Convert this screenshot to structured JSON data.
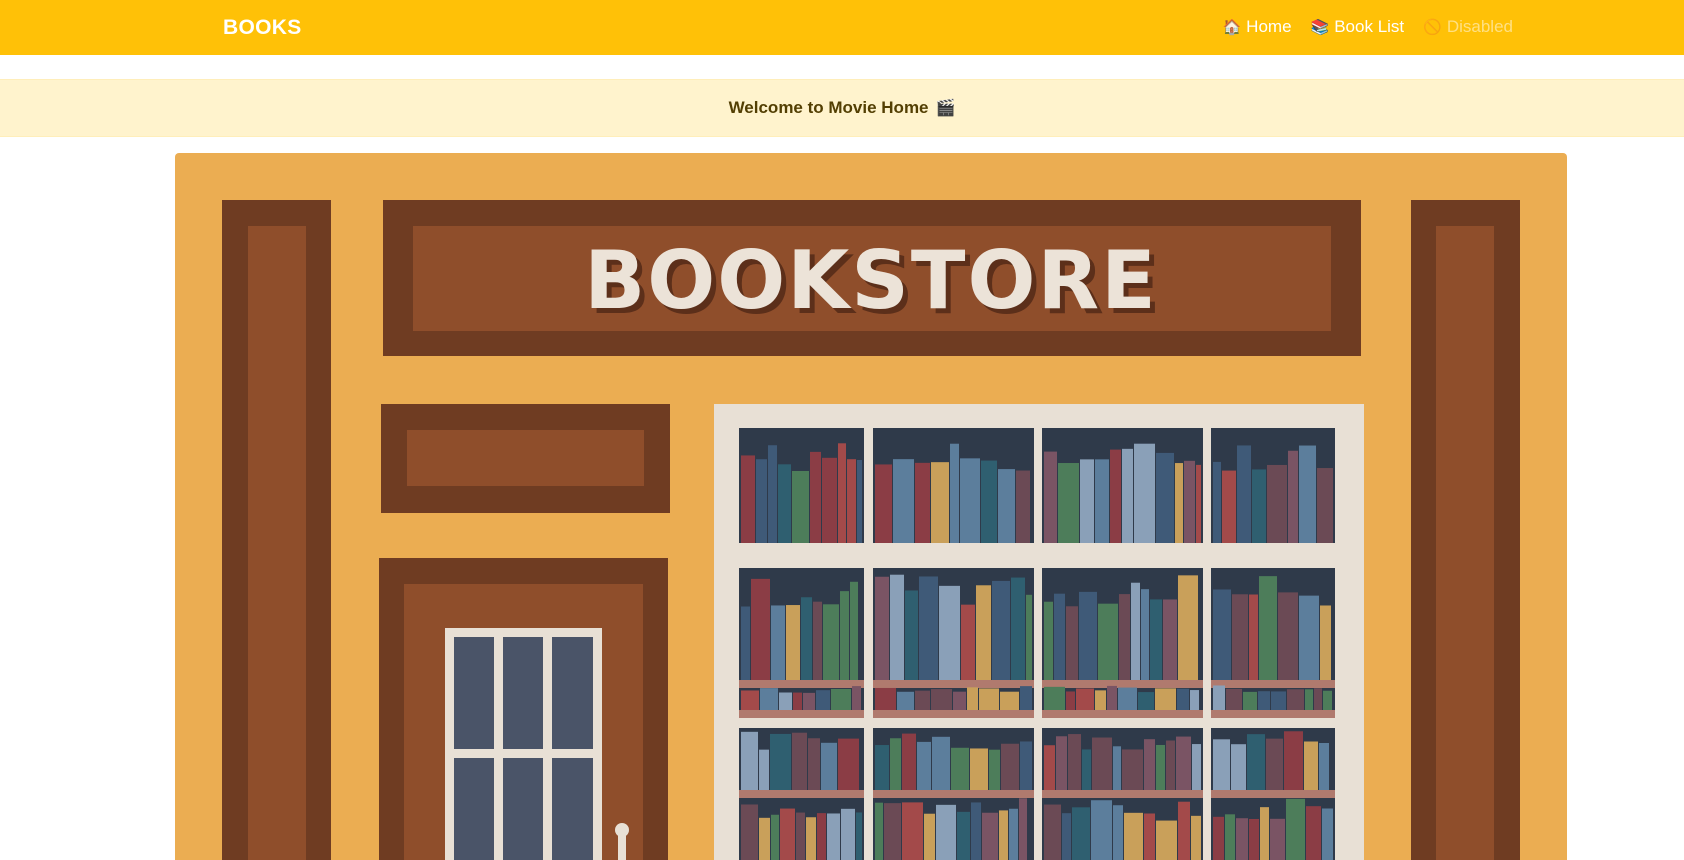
{
  "navbar": {
    "brand": "BOOKS",
    "links": [
      {
        "icon": "🏠",
        "label": "Home",
        "disabled": false
      },
      {
        "icon": "📚",
        "label": "Book List",
        "disabled": false
      },
      {
        "icon": "🚫",
        "label": "Disabled",
        "disabled": true
      }
    ]
  },
  "alert": {
    "text": "Welcome to Movie Home",
    "icon": "🎬"
  },
  "hero": {
    "sign_text": "BOOKSTORE",
    "colors": {
      "wall": "#ebad52",
      "wood_dark": "#6f3c22",
      "wood_mid": "#8f4e2b",
      "window_frame": "#e8e0d5",
      "glass_dark": "#2f3a4a",
      "door_glass": "#4a5468",
      "shelf": "#b07a6e"
    }
  }
}
